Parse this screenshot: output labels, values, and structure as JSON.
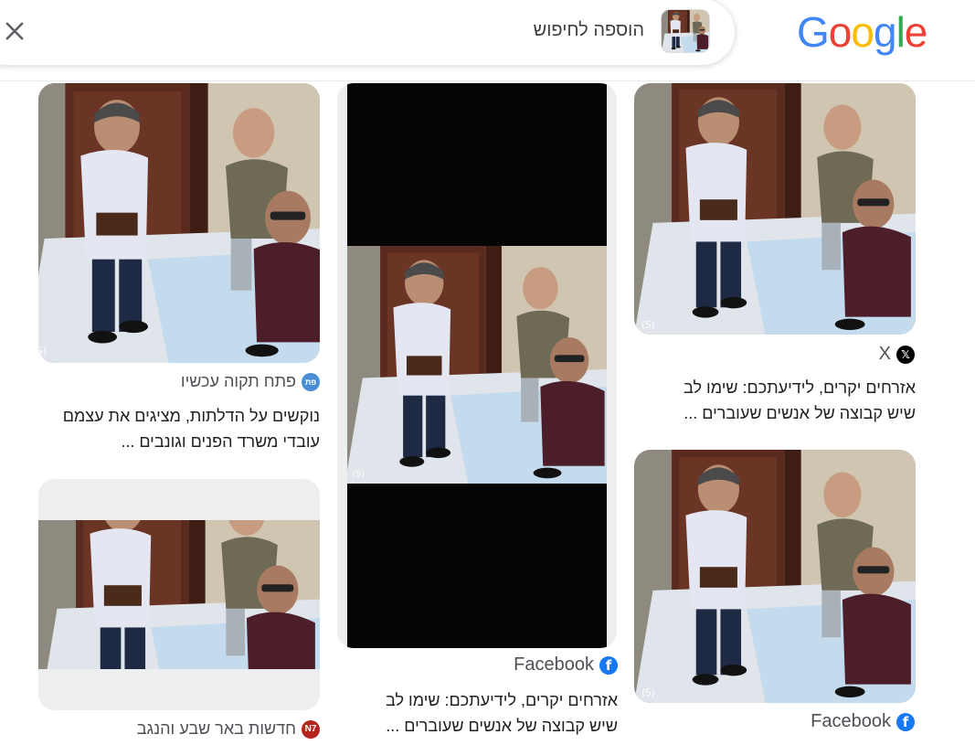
{
  "header": {
    "logo": {
      "g1": "G",
      "o1": "o",
      "o2": "o",
      "g2": "g",
      "l": "l",
      "e": "e"
    },
    "search_label": "הוספה לחיפוש",
    "close_icon": "close-icon",
    "thumb_icon": "search-image-thumbnail"
  },
  "colors": {
    "google_blue": "#4285F4",
    "google_red": "#EA4335",
    "google_yellow": "#FBBC05",
    "google_green": "#34A853",
    "facebook": "#1877F2"
  },
  "results": [
    {
      "source": "X",
      "icon": "x-logo-icon",
      "caption_line1": "אזרחים יקרים, לידיעתכם: שימו לב",
      "caption_line2": "שיש קבוצה של אנשים שעוברים ..."
    },
    {
      "source": "Facebook",
      "icon": "facebook-logo-icon"
    },
    {
      "source": "Facebook",
      "icon": "facebook-logo-icon",
      "caption_line1": "אזרחים יקרים, לידיעתכם: שימו לב",
      "caption_line2": "שיש קבוצה של אנשים שעוברים ..."
    },
    {
      "source": "פתח תקוה עכשיו",
      "icon_text": "פת",
      "icon": "petah-tikva-now-logo-icon",
      "caption_line1": "נוקשים על הדלתות, מציגים את עצמם",
      "caption_line2": "עובדי משרד הפנים וגונבים ..."
    },
    {
      "source": "חדשות באר שבע והנגב",
      "icon_text": "N7",
      "icon": "n7-logo-icon"
    }
  ]
}
